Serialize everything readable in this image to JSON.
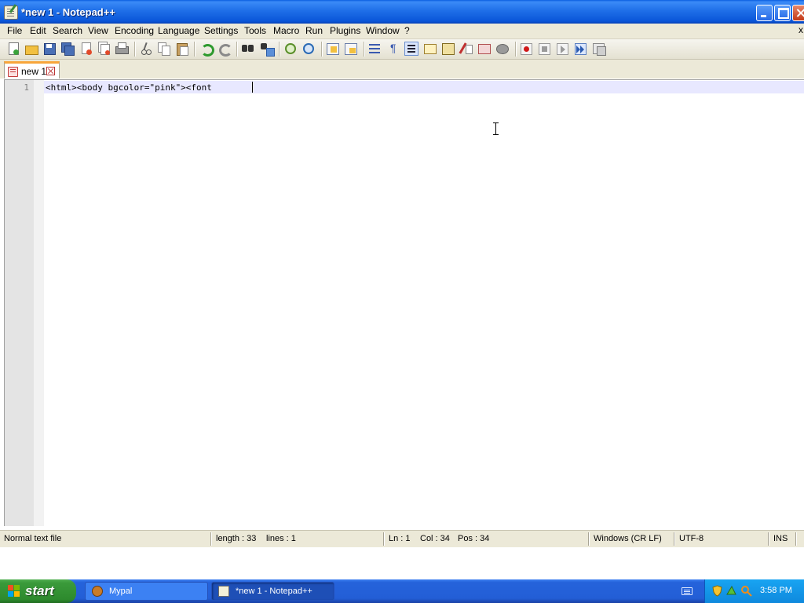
{
  "window": {
    "title": "*new 1 - Notepad++"
  },
  "menubar": {
    "items": [
      "File",
      "Edit",
      "Search",
      "View",
      "Encoding",
      "Language",
      "Settings",
      "Tools",
      "Macro",
      "Run",
      "Plugins",
      "Window",
      "?"
    ],
    "doc_close": "x"
  },
  "toolbar": {
    "icons": [
      "new-file-icon",
      "open-file-icon",
      "save-icon",
      "save-all-icon",
      "close-icon",
      "close-all-icon",
      "print-icon",
      "cut-icon",
      "copy-icon",
      "paste-icon",
      "undo-icon",
      "redo-icon",
      "find-icon",
      "replace-icon",
      "zoom-in-icon",
      "zoom-out-icon",
      "sync-vertical-icon",
      "sync-horizontal-icon",
      "word-wrap-icon",
      "show-all-chars-icon",
      "indent-guide-icon",
      "user-defined-language-icon",
      "document-map-icon",
      "function-list-icon",
      "folder-as-workspace-icon",
      "monitoring-icon",
      "record-macro-icon",
      "stop-recording-icon",
      "play-macro-icon",
      "run-macro-multiple-icon",
      "save-macro-icon"
    ]
  },
  "tabs": [
    {
      "label": "new 1",
      "active": true,
      "modified": true
    }
  ],
  "editor": {
    "lines": [
      {
        "number": "1",
        "text": "<html><body bgcolor=\"pink\"><font "
      }
    ]
  },
  "statusbar": {
    "file_type": "Normal text file",
    "length": "length : 33",
    "lines": "lines : 1",
    "ln": "Ln : 1",
    "col": "Col : 34",
    "pos": "Pos : 34",
    "eol": "Windows (CR LF)",
    "encoding": "UTF-8",
    "mode": "INS"
  },
  "taskbar": {
    "start_label": "start",
    "tasks": [
      {
        "label": "Mypal",
        "active": false
      },
      {
        "label": "*new 1 - Notepad++",
        "active": true
      }
    ],
    "clock": "3:58 PM"
  },
  "colors": {
    "title_bar": "#0a55d8",
    "menu_bg": "#ece9d8",
    "current_line": "#e8e8ff",
    "taskbar": "#235ed6",
    "start_button": "#3a9a3a"
  }
}
